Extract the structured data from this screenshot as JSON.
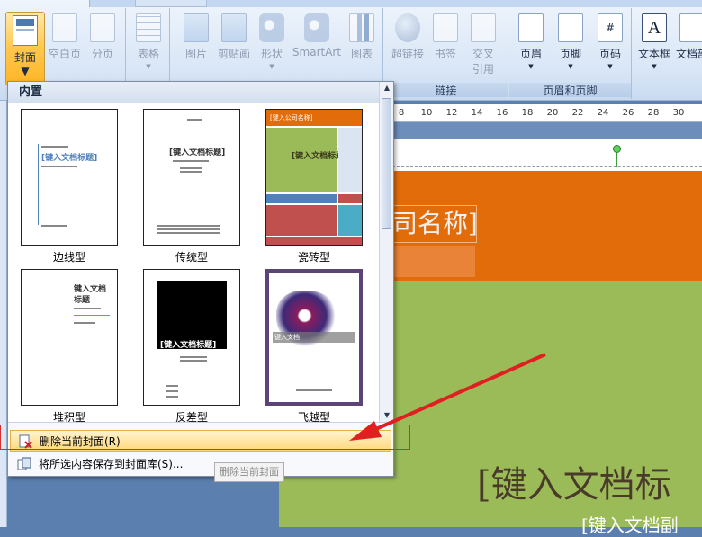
{
  "ribbon": {
    "cover": "封面",
    "blank_page": "空白页",
    "page_break": "分页",
    "table": "表格",
    "picture": "图片",
    "clipart": "剪贴画",
    "shapes": "形状",
    "smartart": "SmartArt",
    "chart": "图表",
    "hyperlink": "超链接",
    "bookmark": "书签",
    "cross_ref_1": "交叉",
    "cross_ref_2": "引用",
    "header": "页眉",
    "footer": "页脚",
    "page_number": "页码",
    "textbox": "文本框",
    "docparts": "文档部",
    "group_links": "链接",
    "group_header_footer": "页眉和页脚"
  },
  "gallery": {
    "section": "内置",
    "templates": [
      {
        "name": "边线型"
      },
      {
        "name": "传统型"
      },
      {
        "name": "瓷砖型"
      },
      {
        "name": "堆积型"
      },
      {
        "name": "反差型"
      },
      {
        "name": "飞越型"
      }
    ],
    "thumb_text": {
      "title": "[键入文档标题]",
      "title_a": "键入文档",
      "title_b": "标题",
      "company": "[键入公司名称]"
    },
    "menu": {
      "remove_cover": "删除当前封面(R)",
      "save_selection": "将所选内容保存到封面库(S)..."
    }
  },
  "tooltip": "删除当前封面",
  "ruler_ticks": [
    "8",
    "10",
    "12",
    "14",
    "16",
    "18",
    "20",
    "22",
    "24",
    "26",
    "28",
    "30"
  ],
  "document": {
    "company": "司名称]",
    "title": "[键入文档标",
    "subtitle": "[键入文档副"
  },
  "colors": {
    "orange": "#e36c0a",
    "green": "#9bbb59",
    "highlight": "#ffd97a",
    "annotation_red": "#e02020"
  }
}
